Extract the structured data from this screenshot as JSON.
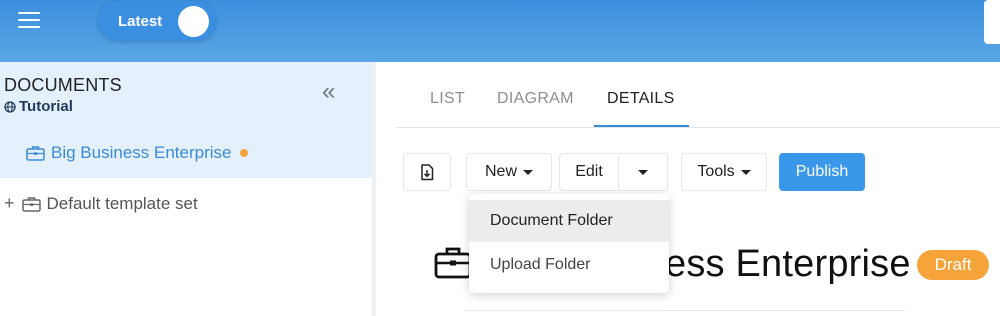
{
  "header": {
    "toggle_label": "Latest"
  },
  "sidebar": {
    "section_title": "DOCUMENTS",
    "collapse_glyph": "«",
    "project_name": "Tutorial",
    "items": [
      {
        "label": "Big Business Enterprise",
        "active": true,
        "status_dot_color": "#f5a23a"
      },
      {
        "label": "Default template set",
        "expand_glyph": "+"
      }
    ]
  },
  "tabs": [
    {
      "label": "LIST"
    },
    {
      "label": "DIAGRAM"
    },
    {
      "label": "DETAILS",
      "active": true
    }
  ],
  "toolbar": {
    "new_label": "New",
    "edit_label": "Edit",
    "tools_label": "Tools",
    "publish_label": "Publish"
  },
  "dropdown": {
    "items": [
      {
        "label": "Document Folder",
        "highlighted": true
      },
      {
        "label": "Upload Folder"
      }
    ]
  },
  "page": {
    "title_visible_fragment": "ess Enterprise",
    "status_badge": "Draft"
  },
  "colors": {
    "accent": "#3a8ad6",
    "header_top": "#3b8fdc",
    "sidebar_active_bg": "#e4f1fc",
    "draft_badge": "#f6a33a",
    "publish_button": "#3a98ea"
  },
  "icons": [
    "menu-icon",
    "double-chevron-left-icon",
    "globe-icon",
    "briefcase-icon",
    "import-icon",
    "caret-down-icon"
  ]
}
